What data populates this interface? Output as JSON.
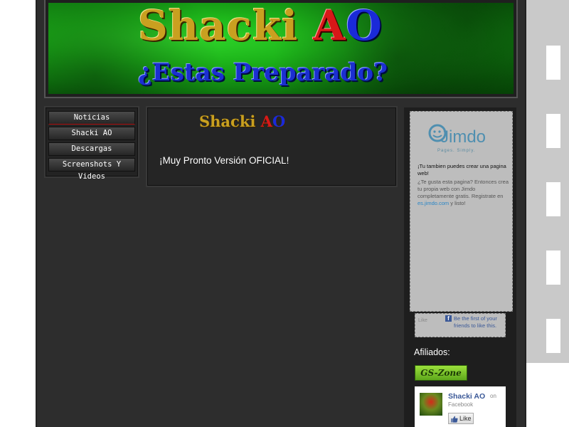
{
  "header": {
    "title_part1": "Shacki ",
    "title_a": "A",
    "title_o": "O",
    "subtitle": "¿Estas Preparado?"
  },
  "nav": {
    "items": [
      {
        "label": "Noticias"
      },
      {
        "label": "Shacki AO"
      },
      {
        "label": "Descargas"
      },
      {
        "label": "Screenshots Y Videos"
      }
    ]
  },
  "content": {
    "logo_part1": "Shacki ",
    "logo_a": "A",
    "logo_o": "O",
    "text": "¡Muy Pronto Versión OFICIAL!"
  },
  "sidebar": {
    "jimdo_logo": "Jimdo",
    "jimdo_tagline": "Pages. Simply.",
    "ad_heading": "¡Tu tambien puedes crear una pagina web!",
    "ad_body_start": "¿Te gusta esta pagina? Entonces crea tu propia web con Jimdo completamente gratis. Registrate en ",
    "ad_link": "es.jimdo.com",
    "ad_body_end": " y listo!",
    "fb_like_small": "Like",
    "fb_strip_text": "Be the first of your friends to like this.",
    "affiliates_label": "Afiliados:",
    "affiliate_badge": "GS-Zone",
    "fb_page_name": "Shacki AO",
    "fb_on": "on",
    "fb_platform": "Facebook",
    "fb_like_button": "Like"
  },
  "colors": {
    "page_bg": "#2d2d2d",
    "banner_green": "#1db51a",
    "title_gold": "#c9a020",
    "title_red": "#d81818",
    "title_blue": "#1a2ad8",
    "facebook_blue": "#3b5998"
  },
  "icons": {
    "jimdo": "jimdo-logo-icon",
    "facebook": "facebook-f-icon",
    "like": "thumbs-up-icon"
  }
}
